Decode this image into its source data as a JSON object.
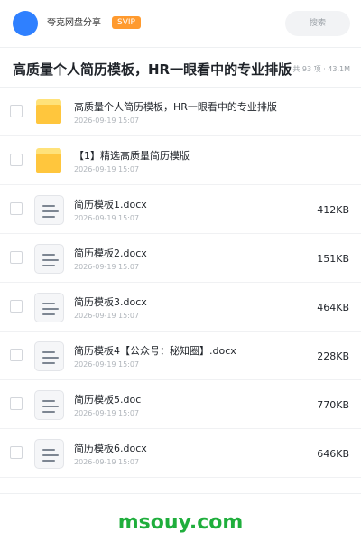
{
  "header": {
    "app_name": "夸克网盘分享",
    "badge": "SVIP",
    "search_placeholder": "搜索"
  },
  "folder": {
    "title": "高质量个人简历模板，HR一眼看中的专业排版",
    "meta": "共 93 项 · 43.1M"
  },
  "files": [
    {
      "type": "folder",
      "icon": "folder-icon",
      "name": "高质量个人简历模板，HR一眼看中的专业排版",
      "date": "2026-09-19 15:07",
      "size": ""
    },
    {
      "type": "folder",
      "icon": "folder-icon",
      "name": "【1】精选高质量简历模版",
      "date": "2026-09-19 15:07",
      "size": ""
    },
    {
      "type": "file",
      "icon": "document-icon",
      "name": "简历模板1.docx",
      "date": "2026-09-19 15:07",
      "size": "412KB"
    },
    {
      "type": "file",
      "icon": "document-icon",
      "name": "简历模板2.docx",
      "date": "2026-09-19 15:07",
      "size": "151KB"
    },
    {
      "type": "file",
      "icon": "document-icon",
      "name": "简历模板3.docx",
      "date": "2026-09-19 15:07",
      "size": "464KB"
    },
    {
      "type": "file",
      "icon": "document-icon",
      "name": "简历模板4【公众号：秘知圈】.docx",
      "date": "2026-09-19 15:07",
      "size": "228KB"
    },
    {
      "type": "file",
      "icon": "document-icon",
      "name": "简历模板5.doc",
      "date": "2026-09-19 15:07",
      "size": "770KB"
    },
    {
      "type": "file",
      "icon": "document-icon",
      "name": "简历模板6.docx",
      "date": "2026-09-19 15:07",
      "size": "646KB"
    }
  ],
  "watermark": "msouy.com",
  "colors": {
    "accent": "#2f80ff",
    "badge": "#ff9a2e",
    "folder": "#ffc63d",
    "watermark": "#1fae3c"
  }
}
